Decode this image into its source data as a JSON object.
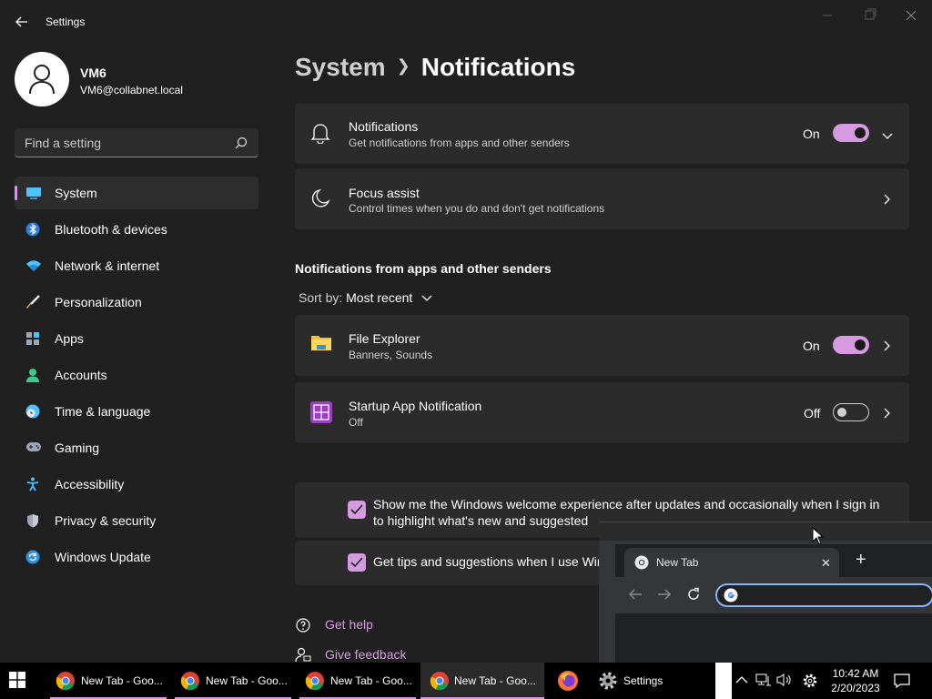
{
  "app": {
    "title": "Settings"
  },
  "profile": {
    "name": "VM6",
    "email": "VM6@collabnet.local"
  },
  "search": {
    "placeholder": "Find a setting"
  },
  "sidebar": {
    "items": [
      {
        "label": "System",
        "icon": "monitor-icon",
        "selected": true
      },
      {
        "label": "Bluetooth & devices",
        "icon": "bluetooth-icon"
      },
      {
        "label": "Network & internet",
        "icon": "wifi-icon"
      },
      {
        "label": "Personalization",
        "icon": "brush-icon"
      },
      {
        "label": "Apps",
        "icon": "apps-icon"
      },
      {
        "label": "Accounts",
        "icon": "person-icon"
      },
      {
        "label": "Time & language",
        "icon": "clock-globe-icon"
      },
      {
        "label": "Gaming",
        "icon": "gamepad-icon"
      },
      {
        "label": "Accessibility",
        "icon": "accessibility-icon"
      },
      {
        "label": "Privacy & security",
        "icon": "shield-icon"
      },
      {
        "label": "Windows Update",
        "icon": "update-icon"
      }
    ]
  },
  "breadcrumb": {
    "parent": "System",
    "current": "Notifications"
  },
  "main": {
    "notifications": {
      "title": "Notifications",
      "subtitle": "Get notifications from apps and other senders",
      "state": "On"
    },
    "focus_assist": {
      "title": "Focus assist",
      "subtitle": "Control times when you do and don't get notifications"
    },
    "section_title": "Notifications from apps and other senders",
    "sort": {
      "label": "Sort by:",
      "value": "Most recent"
    },
    "apps": [
      {
        "name": "File Explorer",
        "detail": "Banners, Sounds",
        "state": "On"
      },
      {
        "name": "Startup App Notification",
        "detail": "Off",
        "state": "Off"
      }
    ],
    "checks": [
      {
        "text": "Show me the Windows welcome experience after updates and occasionally when I sign in to highlight what's new and suggested"
      },
      {
        "text": "Get tips and suggestions when I use Wir"
      }
    ],
    "links": {
      "get_help": "Get help",
      "give_feedback": "Give feedback"
    }
  },
  "chrome": {
    "tab_title": "New Tab",
    "close": "✕",
    "newtab": "+"
  },
  "taskbar": {
    "items": [
      {
        "label": "New Tab - Goo..."
      },
      {
        "label": "New Tab - Goo..."
      },
      {
        "label": "New Tab - Goo..."
      },
      {
        "label": "New Tab - Goo..."
      },
      {
        "label": "Settings"
      }
    ],
    "time": "10:42 AM",
    "date": "2/20/2023"
  },
  "colors": {
    "accent": "#d69ae0",
    "background": "#202020",
    "card": "#2b2b2b"
  }
}
